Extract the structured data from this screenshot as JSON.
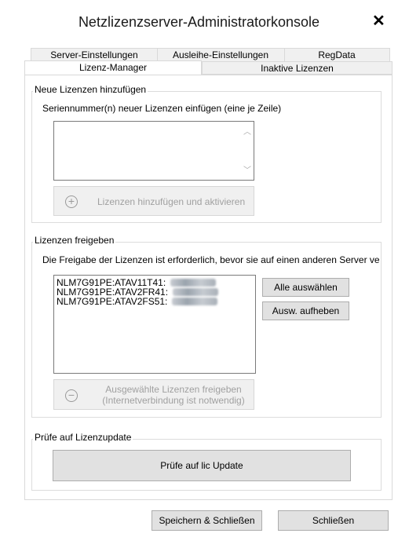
{
  "window": {
    "title": "Netzlizenzserver-Administratorkonsole",
    "close_glyph": "✕"
  },
  "tabs": {
    "row1": [
      "Server-Einstellungen",
      "Ausleihe-Einstellungen",
      "RegData"
    ],
    "row2": [
      "Lizenz-Manager",
      "Inaktive Lizenzen"
    ]
  },
  "add_group": {
    "title": "Neue Lizenzen hinzufügen",
    "instruction": "Seriennummer(n) neuer Lizenzen einfügen (eine je Zeile)",
    "textarea_value": "",
    "add_button_label": "Lizenzen hinzufügen und aktivieren"
  },
  "release_group": {
    "title": "Lizenzen freigeben",
    "instruction": "Die Freigabe der Lizenzen ist erforderlich, bevor sie auf einen anderen Server ve",
    "licenses": [
      "NLM7G91PE:ATAV11T41:",
      "NLM7G91PE:ATAV2FR41:",
      "NLM7G91PE:ATAV2FS51:"
    ],
    "select_all_label": "Alle auswählen",
    "deselect_label": "Ausw. aufheben",
    "release_button_line1": "Ausgewählte Lizenzen freigeben",
    "release_button_line2": "(Internetverbindung ist notwendig)"
  },
  "update_group": {
    "title": "Prüfe auf Lizenzupdate",
    "check_button_label": "Prüfe auf lic Update"
  },
  "footer": {
    "save_close_label": "Speichern & Schließen",
    "close_label": "Schließen"
  }
}
